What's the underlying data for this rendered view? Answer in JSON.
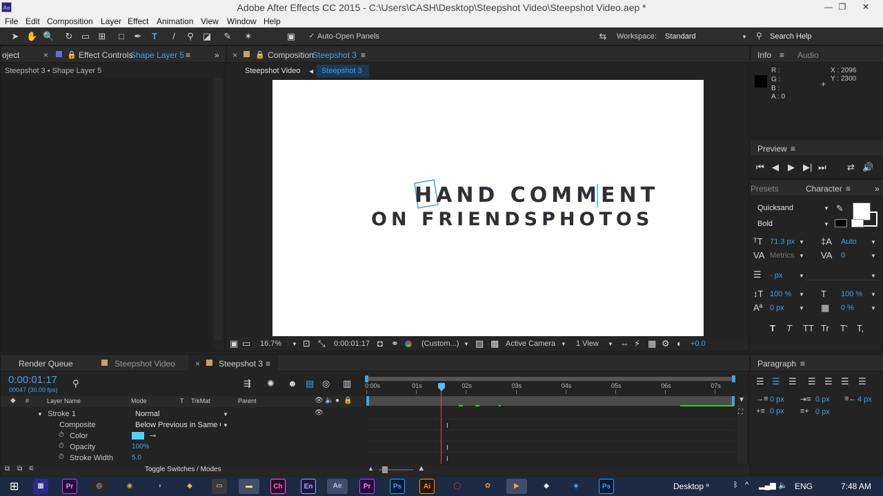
{
  "app": {
    "window_title": "Adobe After Effects CC 2015 - C:\\Users\\CASH\\Desktop\\Steepshot Video\\Steepshot Video.aep *",
    "logo": "Ae"
  },
  "menu": [
    "File",
    "Edit",
    "Composition",
    "Layer",
    "Effect",
    "Animation",
    "View",
    "Window",
    "Help"
  ],
  "toolbar": {
    "auto_open_panels": "Auto-Open Panels",
    "workspace_label": "Workspace:",
    "workspace_value": "Standard",
    "search_help": "Search Help"
  },
  "left_panel": {
    "tab_project": "oject",
    "tab_effect_controls": "Effect Controls",
    "tab_effect_layer": "Shape Layer 5",
    "breadcrumb": "Steepshot 3 • Shape Layer 5"
  },
  "composition": {
    "tab_label": "Composition",
    "tab_comp": "Steepshot 3",
    "flow_prev": "Steepshot Video",
    "flow_current": "Steepshot 3",
    "text_line1": "HAND COMMENT",
    "text_line2": "ON FRIENDSPHOTOS",
    "zoom": "16.7%",
    "timecode": "0:00:01:17",
    "resolution": "(Custom...)",
    "camera": "Active Camera",
    "views": "1 View",
    "exposure": "+0.0"
  },
  "info_panel": {
    "tab_info": "Info",
    "tab_audio": "Audio",
    "r": "R :",
    "g": "G :",
    "b": "B :",
    "a": "A : 0",
    "x": "X : 2096",
    "y": "Y : 2300"
  },
  "preview_panel": {
    "title": "Preview"
  },
  "character_panel": {
    "tab_presets": "Presets",
    "tab_character": "Character",
    "font": "Quicksand",
    "style": "Bold",
    "size": "71.3 px",
    "leading": "Auto",
    "kerning": "Metrics",
    "tracking": "0",
    "stroke_width": "- px",
    "vscale": "100 %",
    "hscale": "100 %",
    "baseline": "0 px",
    "tsume": "0 %",
    "styles": [
      "T",
      "T",
      "TT",
      "Tr",
      "T'",
      "T,"
    ]
  },
  "paragraph_panel": {
    "title": "Paragraph",
    "indent_left": "0 px",
    "indent_first": "0 px",
    "indent_right": "4 px",
    "space_before": "0 px",
    "space_after": "0 px"
  },
  "timeline": {
    "tab_render_queue": "Render Queue",
    "tab_steepshot_video": "Steepshot Video",
    "tab_steepshot3": "Steepshot 3",
    "timecode": "0:00:01:17",
    "frame_info": "00047 (30.00 fps)",
    "col_layer_name": "Layer Name",
    "col_mode": "Mode",
    "col_t": "T",
    "col_trkmat": "TrkMat",
    "col_parent": "Parent",
    "ruler": [
      "0:00s",
      "01s",
      "02s",
      "03s",
      "04s",
      "05s",
      "06s",
      "07s"
    ],
    "playhead_fraction": 0.222,
    "rows": [
      {
        "label": "Stroke 1",
        "value": "Normal"
      },
      {
        "label": "Composite",
        "value": "Below Previous in Same Gr"
      },
      {
        "label": "Color",
        "value": ""
      },
      {
        "label": "Opacity",
        "value": "100%"
      },
      {
        "label": "Stroke Width",
        "value": "5.0"
      }
    ],
    "stroke_color": "#4fd3f0",
    "toggle_label": "Toggle Switches / Modes"
  },
  "taskbar": {
    "desktop": "Desktop",
    "lang": "ENG",
    "time": "7:48 AM",
    "apps": [
      "Pr",
      "Ch",
      "En",
      "Ae",
      "Pr",
      "Ps",
      "Ai",
      "Ps"
    ]
  },
  "colors": {
    "accent": "#3fa3e8",
    "playhead": "#e8493f",
    "comp_bg": "#ffffff",
    "text_dark": "#2f2f35",
    "taskbar": "#1c2a44"
  }
}
